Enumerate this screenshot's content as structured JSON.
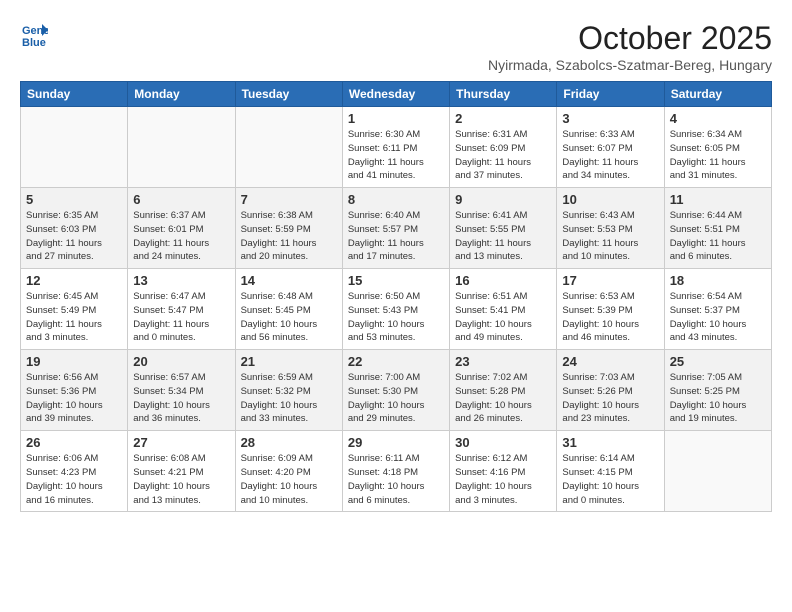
{
  "header": {
    "logo_line1": "General",
    "logo_line2": "Blue",
    "month": "October 2025",
    "location": "Nyirmada, Szabolcs-Szatmar-Bereg, Hungary"
  },
  "weekdays": [
    "Sunday",
    "Monday",
    "Tuesday",
    "Wednesday",
    "Thursday",
    "Friday",
    "Saturday"
  ],
  "weeks": [
    [
      {
        "day": "",
        "info": ""
      },
      {
        "day": "",
        "info": ""
      },
      {
        "day": "",
        "info": ""
      },
      {
        "day": "1",
        "info": "Sunrise: 6:30 AM\nSunset: 6:11 PM\nDaylight: 11 hours\nand 41 minutes."
      },
      {
        "day": "2",
        "info": "Sunrise: 6:31 AM\nSunset: 6:09 PM\nDaylight: 11 hours\nand 37 minutes."
      },
      {
        "day": "3",
        "info": "Sunrise: 6:33 AM\nSunset: 6:07 PM\nDaylight: 11 hours\nand 34 minutes."
      },
      {
        "day": "4",
        "info": "Sunrise: 6:34 AM\nSunset: 6:05 PM\nDaylight: 11 hours\nand 31 minutes."
      }
    ],
    [
      {
        "day": "5",
        "info": "Sunrise: 6:35 AM\nSunset: 6:03 PM\nDaylight: 11 hours\nand 27 minutes."
      },
      {
        "day": "6",
        "info": "Sunrise: 6:37 AM\nSunset: 6:01 PM\nDaylight: 11 hours\nand 24 minutes."
      },
      {
        "day": "7",
        "info": "Sunrise: 6:38 AM\nSunset: 5:59 PM\nDaylight: 11 hours\nand 20 minutes."
      },
      {
        "day": "8",
        "info": "Sunrise: 6:40 AM\nSunset: 5:57 PM\nDaylight: 11 hours\nand 17 minutes."
      },
      {
        "day": "9",
        "info": "Sunrise: 6:41 AM\nSunset: 5:55 PM\nDaylight: 11 hours\nand 13 minutes."
      },
      {
        "day": "10",
        "info": "Sunrise: 6:43 AM\nSunset: 5:53 PM\nDaylight: 11 hours\nand 10 minutes."
      },
      {
        "day": "11",
        "info": "Sunrise: 6:44 AM\nSunset: 5:51 PM\nDaylight: 11 hours\nand 6 minutes."
      }
    ],
    [
      {
        "day": "12",
        "info": "Sunrise: 6:45 AM\nSunset: 5:49 PM\nDaylight: 11 hours\nand 3 minutes."
      },
      {
        "day": "13",
        "info": "Sunrise: 6:47 AM\nSunset: 5:47 PM\nDaylight: 11 hours\nand 0 minutes."
      },
      {
        "day": "14",
        "info": "Sunrise: 6:48 AM\nSunset: 5:45 PM\nDaylight: 10 hours\nand 56 minutes."
      },
      {
        "day": "15",
        "info": "Sunrise: 6:50 AM\nSunset: 5:43 PM\nDaylight: 10 hours\nand 53 minutes."
      },
      {
        "day": "16",
        "info": "Sunrise: 6:51 AM\nSunset: 5:41 PM\nDaylight: 10 hours\nand 49 minutes."
      },
      {
        "day": "17",
        "info": "Sunrise: 6:53 AM\nSunset: 5:39 PM\nDaylight: 10 hours\nand 46 minutes."
      },
      {
        "day": "18",
        "info": "Sunrise: 6:54 AM\nSunset: 5:37 PM\nDaylight: 10 hours\nand 43 minutes."
      }
    ],
    [
      {
        "day": "19",
        "info": "Sunrise: 6:56 AM\nSunset: 5:36 PM\nDaylight: 10 hours\nand 39 minutes."
      },
      {
        "day": "20",
        "info": "Sunrise: 6:57 AM\nSunset: 5:34 PM\nDaylight: 10 hours\nand 36 minutes."
      },
      {
        "day": "21",
        "info": "Sunrise: 6:59 AM\nSunset: 5:32 PM\nDaylight: 10 hours\nand 33 minutes."
      },
      {
        "day": "22",
        "info": "Sunrise: 7:00 AM\nSunset: 5:30 PM\nDaylight: 10 hours\nand 29 minutes."
      },
      {
        "day": "23",
        "info": "Sunrise: 7:02 AM\nSunset: 5:28 PM\nDaylight: 10 hours\nand 26 minutes."
      },
      {
        "day": "24",
        "info": "Sunrise: 7:03 AM\nSunset: 5:26 PM\nDaylight: 10 hours\nand 23 minutes."
      },
      {
        "day": "25",
        "info": "Sunrise: 7:05 AM\nSunset: 5:25 PM\nDaylight: 10 hours\nand 19 minutes."
      }
    ],
    [
      {
        "day": "26",
        "info": "Sunrise: 6:06 AM\nSunset: 4:23 PM\nDaylight: 10 hours\nand 16 minutes."
      },
      {
        "day": "27",
        "info": "Sunrise: 6:08 AM\nSunset: 4:21 PM\nDaylight: 10 hours\nand 13 minutes."
      },
      {
        "day": "28",
        "info": "Sunrise: 6:09 AM\nSunset: 4:20 PM\nDaylight: 10 hours\nand 10 minutes."
      },
      {
        "day": "29",
        "info": "Sunrise: 6:11 AM\nSunset: 4:18 PM\nDaylight: 10 hours\nand 6 minutes."
      },
      {
        "day": "30",
        "info": "Sunrise: 6:12 AM\nSunset: 4:16 PM\nDaylight: 10 hours\nand 3 minutes."
      },
      {
        "day": "31",
        "info": "Sunrise: 6:14 AM\nSunset: 4:15 PM\nDaylight: 10 hours\nand 0 minutes."
      },
      {
        "day": "",
        "info": ""
      }
    ]
  ]
}
